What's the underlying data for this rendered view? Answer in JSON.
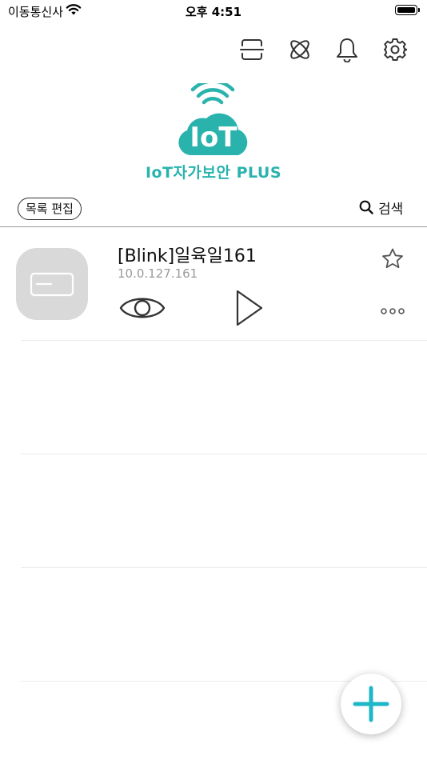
{
  "status_bar": {
    "carrier": "이동통신사",
    "time": "오후 4:51"
  },
  "toolbar_icons": [
    "scan-icon",
    "atom-icon",
    "bell-icon",
    "gear-icon"
  ],
  "logo": {
    "badge_text": "IoT",
    "app_name": "IoT자가보안 PLUS"
  },
  "list_toolbar": {
    "edit_label": "목록 편집",
    "search_label": "검색"
  },
  "devices": [
    {
      "name": "[Blink]일육일161",
      "ip": "10.0.127.161"
    }
  ],
  "colors": {
    "brand": "#2ab3ad",
    "fab_plus": "#1fb6c9",
    "device_tile": "#d9d9d9",
    "icon": "#333333"
  }
}
